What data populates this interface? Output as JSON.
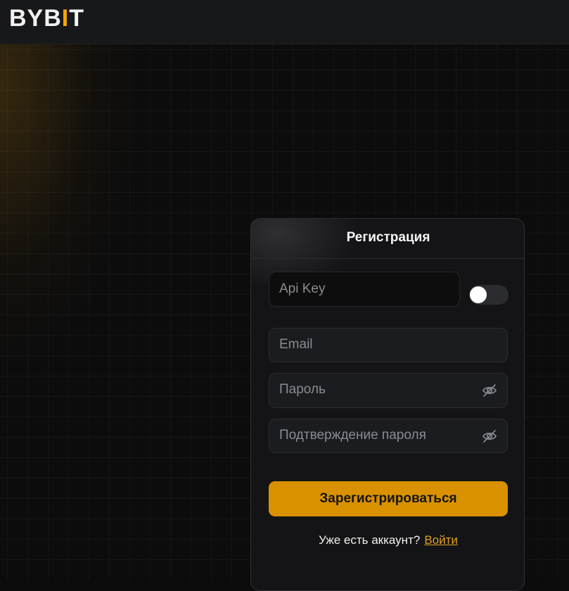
{
  "brand": {
    "logo_prefix": "BYB",
    "logo_accent": "I",
    "logo_suffix": "T",
    "accent_color": "#f7a600"
  },
  "form": {
    "title": "Регистрация",
    "api_key_placeholder": "Api Key",
    "api_key_toggle": "off",
    "email_placeholder": "Email",
    "password_placeholder": "Пароль",
    "password_visibility_icon": "eye-off-icon",
    "confirm_placeholder": "Подтверждение пароля",
    "confirm_visibility_icon": "eye-off-icon",
    "submit_label": "Зарегистрироваться",
    "submit_color": "#d99100",
    "have_account_text": "Уже есть аккаунт?",
    "login_link": "Войти",
    "link_color": "#e0a020"
  }
}
